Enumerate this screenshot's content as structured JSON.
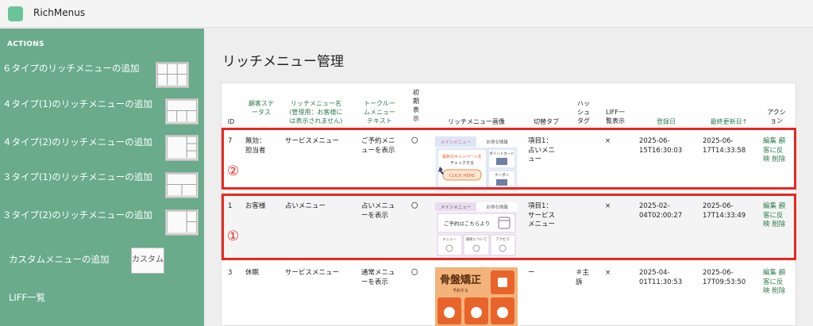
{
  "app": {
    "title": "RichMenus"
  },
  "sidebar": {
    "heading": "ACTIONS",
    "items": [
      {
        "label": "６タイプのリッチメニューの追加"
      },
      {
        "label": "４タイプ(1)のリッチメニューの追加"
      },
      {
        "label": "４タイプ(2)のリッチメニューの追加"
      },
      {
        "label": "３タイプ(1)のリッチメニューの追加"
      },
      {
        "label": "３タイプ(2)のリッチメニューの追加"
      },
      {
        "label": "カスタムメニューの追加",
        "thumb_text": "カスタム"
      },
      {
        "label": "LIFF一覧"
      }
    ]
  },
  "page": {
    "title": "リッチメニュー管理"
  },
  "table": {
    "headers": {
      "id": "ID",
      "customer_status": [
        "顧客ステ",
        "ータス"
      ],
      "menu_name": [
        "リッチメニュー名",
        "(管理用：お客様に",
        "は表示されません)"
      ],
      "talk_text": [
        "トークルー",
        "ムメニュー",
        "テキスト"
      ],
      "initial_display": [
        "初",
        "期",
        "表",
        "示"
      ],
      "menu_image": "リッチメニュー画像",
      "switch_tab": "切替タブ",
      "hashtag": [
        "ハッ",
        "シュ",
        "タグ"
      ],
      "liff_list": [
        "LIFF一",
        "覧表示"
      ],
      "registered": "登録日",
      "last_updated": "最終更新日↑",
      "actions": [
        "アクシ",
        "ョン"
      ]
    },
    "rows": [
      {
        "id": "7",
        "customer_status": [
          "無効：",
          "担当者"
        ],
        "menu_name": "サービスメニュー",
        "talk_text": [
          "ご予約メニ",
          "ューを表示"
        ],
        "initial_display": "〇",
        "switch_tab": [
          "項目1：",
          "占いメニ",
          "ュー"
        ],
        "hashtag": [],
        "liff": "×",
        "registered": [
          "2025-06-",
          "15T16:30:03"
        ],
        "updated": [
          "2025-06-",
          "17T14:33:58"
        ],
        "actions": [
          "編集",
          "顧",
          "客に反",
          "映",
          "削除"
        ],
        "image": {
          "tab_main": "メインメニュー",
          "tab_deals": "お得な情報",
          "campaign": [
            "最新のキャンペーンを",
            "チェックする"
          ],
          "click_here": "CLICK HERE",
          "point_card": "ポイントカード",
          "coupon": "クーポン"
        }
      },
      {
        "id": "1",
        "customer_status": [
          "お客様"
        ],
        "menu_name": "占いメニュー",
        "talk_text": [
          "占いメニュ",
          "ーを表示"
        ],
        "initial_display": "〇",
        "switch_tab": [
          "項目1：",
          "サービス",
          "メニュー"
        ],
        "hashtag": [],
        "liff": "×",
        "registered": [
          "2025-02-",
          "04T02:00:27"
        ],
        "updated": [
          "2025-06-",
          "17T14:33:49"
        ],
        "actions": [
          "編集",
          "顧",
          "客に反",
          "映",
          "削除"
        ],
        "image": {
          "tab_main": "メインメニュー",
          "tab_deals": "お得な情報",
          "reserve": "ご予約はこちらより",
          "menu": "メニュー",
          "about": "施術について",
          "access": "アクセス"
        }
      },
      {
        "id": "3",
        "customer_status": [
          "休眠"
        ],
        "menu_name": "サービスメニュー",
        "talk_text": [
          "通常メニュ",
          "ーを表示"
        ],
        "initial_display": "〇",
        "switch_tab": [
          "ー"
        ],
        "hashtag": [
          "＃主",
          "訴"
        ],
        "liff": "×",
        "registered": [
          "2025-04-",
          "01T11:30:53"
        ],
        "updated": [
          "2025-06-",
          "17T09:53:50"
        ],
        "actions": [
          "編集",
          "顧",
          "客に反",
          "映",
          "削除"
        ],
        "image": {
          "headline": "骨盤矯正",
          "subline": "予約する"
        }
      }
    ]
  },
  "annotations": {
    "label_row1": "②",
    "label_row2": "①"
  },
  "colors": {
    "sidebar": "#69ab8b",
    "accent_green": "#2e7d4f",
    "highlight": "#e8271f",
    "logo": "#6bc497"
  }
}
